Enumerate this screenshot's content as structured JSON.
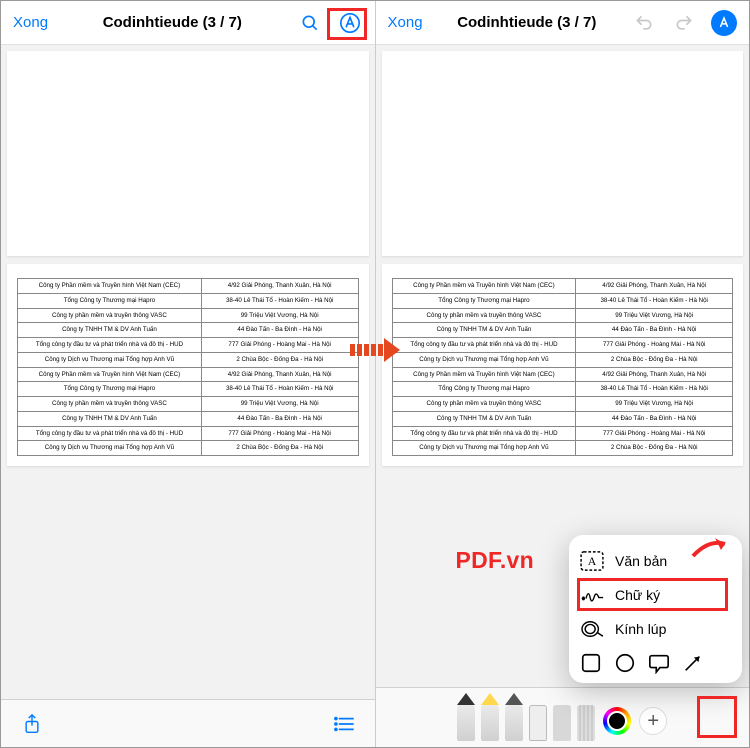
{
  "left": {
    "done": "Xong",
    "title": "Codinhtieude (3 / 7)"
  },
  "right": {
    "done": "Xong",
    "title": "Codinhtieude (3 / 7)"
  },
  "table": {
    "rows": [
      [
        "Công ty Phần mềm và Truyền hình Việt Nam (CEC)",
        "4/92 Giải Phóng, Thanh Xuân, Hà Nội"
      ],
      [
        "Tổng Công ty Thương mại Hapro",
        "38-40 Lê Thái Tổ - Hoàn Kiếm - Hà Nội"
      ],
      [
        "Công ty phần mềm và truyền thông VASC",
        "99 Triệu Việt Vương, Hà Nội"
      ],
      [
        "Công ty TNHH TM & DV Anh Tuấn",
        "44 Đào Tấn - Ba Đình - Hà Nội"
      ],
      [
        "Tổng công ty đầu tư và phát triển nhà và đô thị - HUD",
        "777 Giải Phóng - Hoàng Mai - Hà Nội"
      ],
      [
        "Công ty Dịch vụ Thương mại Tổng hợp Anh Vũ",
        "2 Chùa Bộc - Đống Đa - Hà Nội"
      ],
      [
        "Công ty Phần mềm và Truyền hình Việt Nam (CEC)",
        "4/92 Giải Phóng, Thanh Xuân, Hà Nội"
      ],
      [
        "Tổng Công ty Thương mại Hapro",
        "38-40 Lê Thái Tổ - Hoàn Kiếm - Hà Nội"
      ],
      [
        "Công ty phần mềm và truyền thông VASC",
        "99 Triệu Việt Vương, Hà Nội"
      ],
      [
        "Công ty TNHH TM & DV Anh Tuấn",
        "44 Đào Tấn - Ba Đình - Hà Nội"
      ],
      [
        "Tổng công ty đầu tư và phát triển nhà và đô thị - HUD",
        "777 Giải Phóng - Hoàng Mai - Hà Nội"
      ],
      [
        "Công ty Dịch vụ Thương mại Tổng hợp Anh Vũ",
        "2 Chùa Bộc - Đống Đa - Hà Nội"
      ]
    ]
  },
  "popup": {
    "text": "Văn bản",
    "signature": "Chữ ký",
    "magnifier": "Kính lúp"
  },
  "watermark": "PDF.vn"
}
